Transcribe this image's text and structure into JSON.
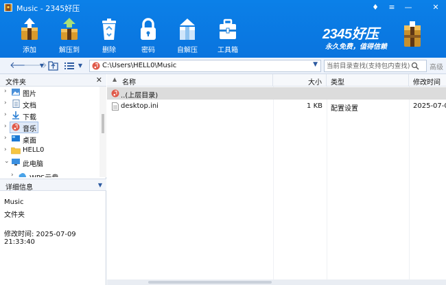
{
  "window": {
    "title": "Music - 2345好压",
    "controls": {
      "pin": "♦",
      "menu": "≡",
      "minimize": "—",
      "close": "✕"
    }
  },
  "toolbar": {
    "items": [
      {
        "label": "添加",
        "icon": "add-icon"
      },
      {
        "label": "解压到",
        "icon": "extract-to-icon"
      },
      {
        "label": "删除",
        "icon": "trash-icon"
      },
      {
        "label": "密码",
        "icon": "lock-icon"
      },
      {
        "label": "自解压",
        "icon": "self-extract-icon"
      },
      {
        "label": "工具箱",
        "icon": "toolbox-icon"
      }
    ]
  },
  "brand": {
    "name": "2345好压",
    "slogan": "永久免费，值得信赖",
    "colors": {
      "header_blue": "#0a78e2"
    }
  },
  "addressbar": {
    "path": "C:\\Users\\HELL0\\Music",
    "search_placeholder": "当前目录查找(支持包内查找)",
    "search_label": "高级"
  },
  "left_pane": {
    "title": "文件夹",
    "close": "✕",
    "tree": [
      {
        "label": "图片",
        "arrow": "›",
        "icon": "pictures-icon"
      },
      {
        "label": "文档",
        "arrow": "›",
        "icon": "documents-icon"
      },
      {
        "label": "下载",
        "arrow": "›",
        "icon": "downloads-icon"
      },
      {
        "label": "音乐",
        "arrow": "›",
        "icon": "music-icon",
        "selected": true
      },
      {
        "label": "桌面",
        "arrow": "›",
        "icon": "desktop-icon"
      },
      {
        "label": "HELL0",
        "arrow": "›",
        "icon": "folder-icon"
      },
      {
        "label": "此电脑",
        "arrow": "⌄",
        "icon": "computer-icon"
      },
      {
        "label": "WPS云盘",
        "arrow": "›",
        "icon": "cloud-icon"
      }
    ]
  },
  "details": {
    "title": "详细信息",
    "toggle": "▼",
    "name": "Music",
    "type": "文件夹",
    "modified": "修改时间:  2025-07-09 21:33:40"
  },
  "file_list": {
    "columns": {
      "name": "名称",
      "size": "大小",
      "type": "类型",
      "modified": "修改时间"
    },
    "sort_arrow": "▲",
    "rows": [
      {
        "name": "..(上层目录)",
        "size": "",
        "type": "",
        "modified": "",
        "icon": "up-level-icon"
      },
      {
        "name": "desktop.ini",
        "size": "1 KB",
        "type": "配置设置",
        "modified": "2025-07-0",
        "icon": "ini-file-icon"
      }
    ]
  }
}
